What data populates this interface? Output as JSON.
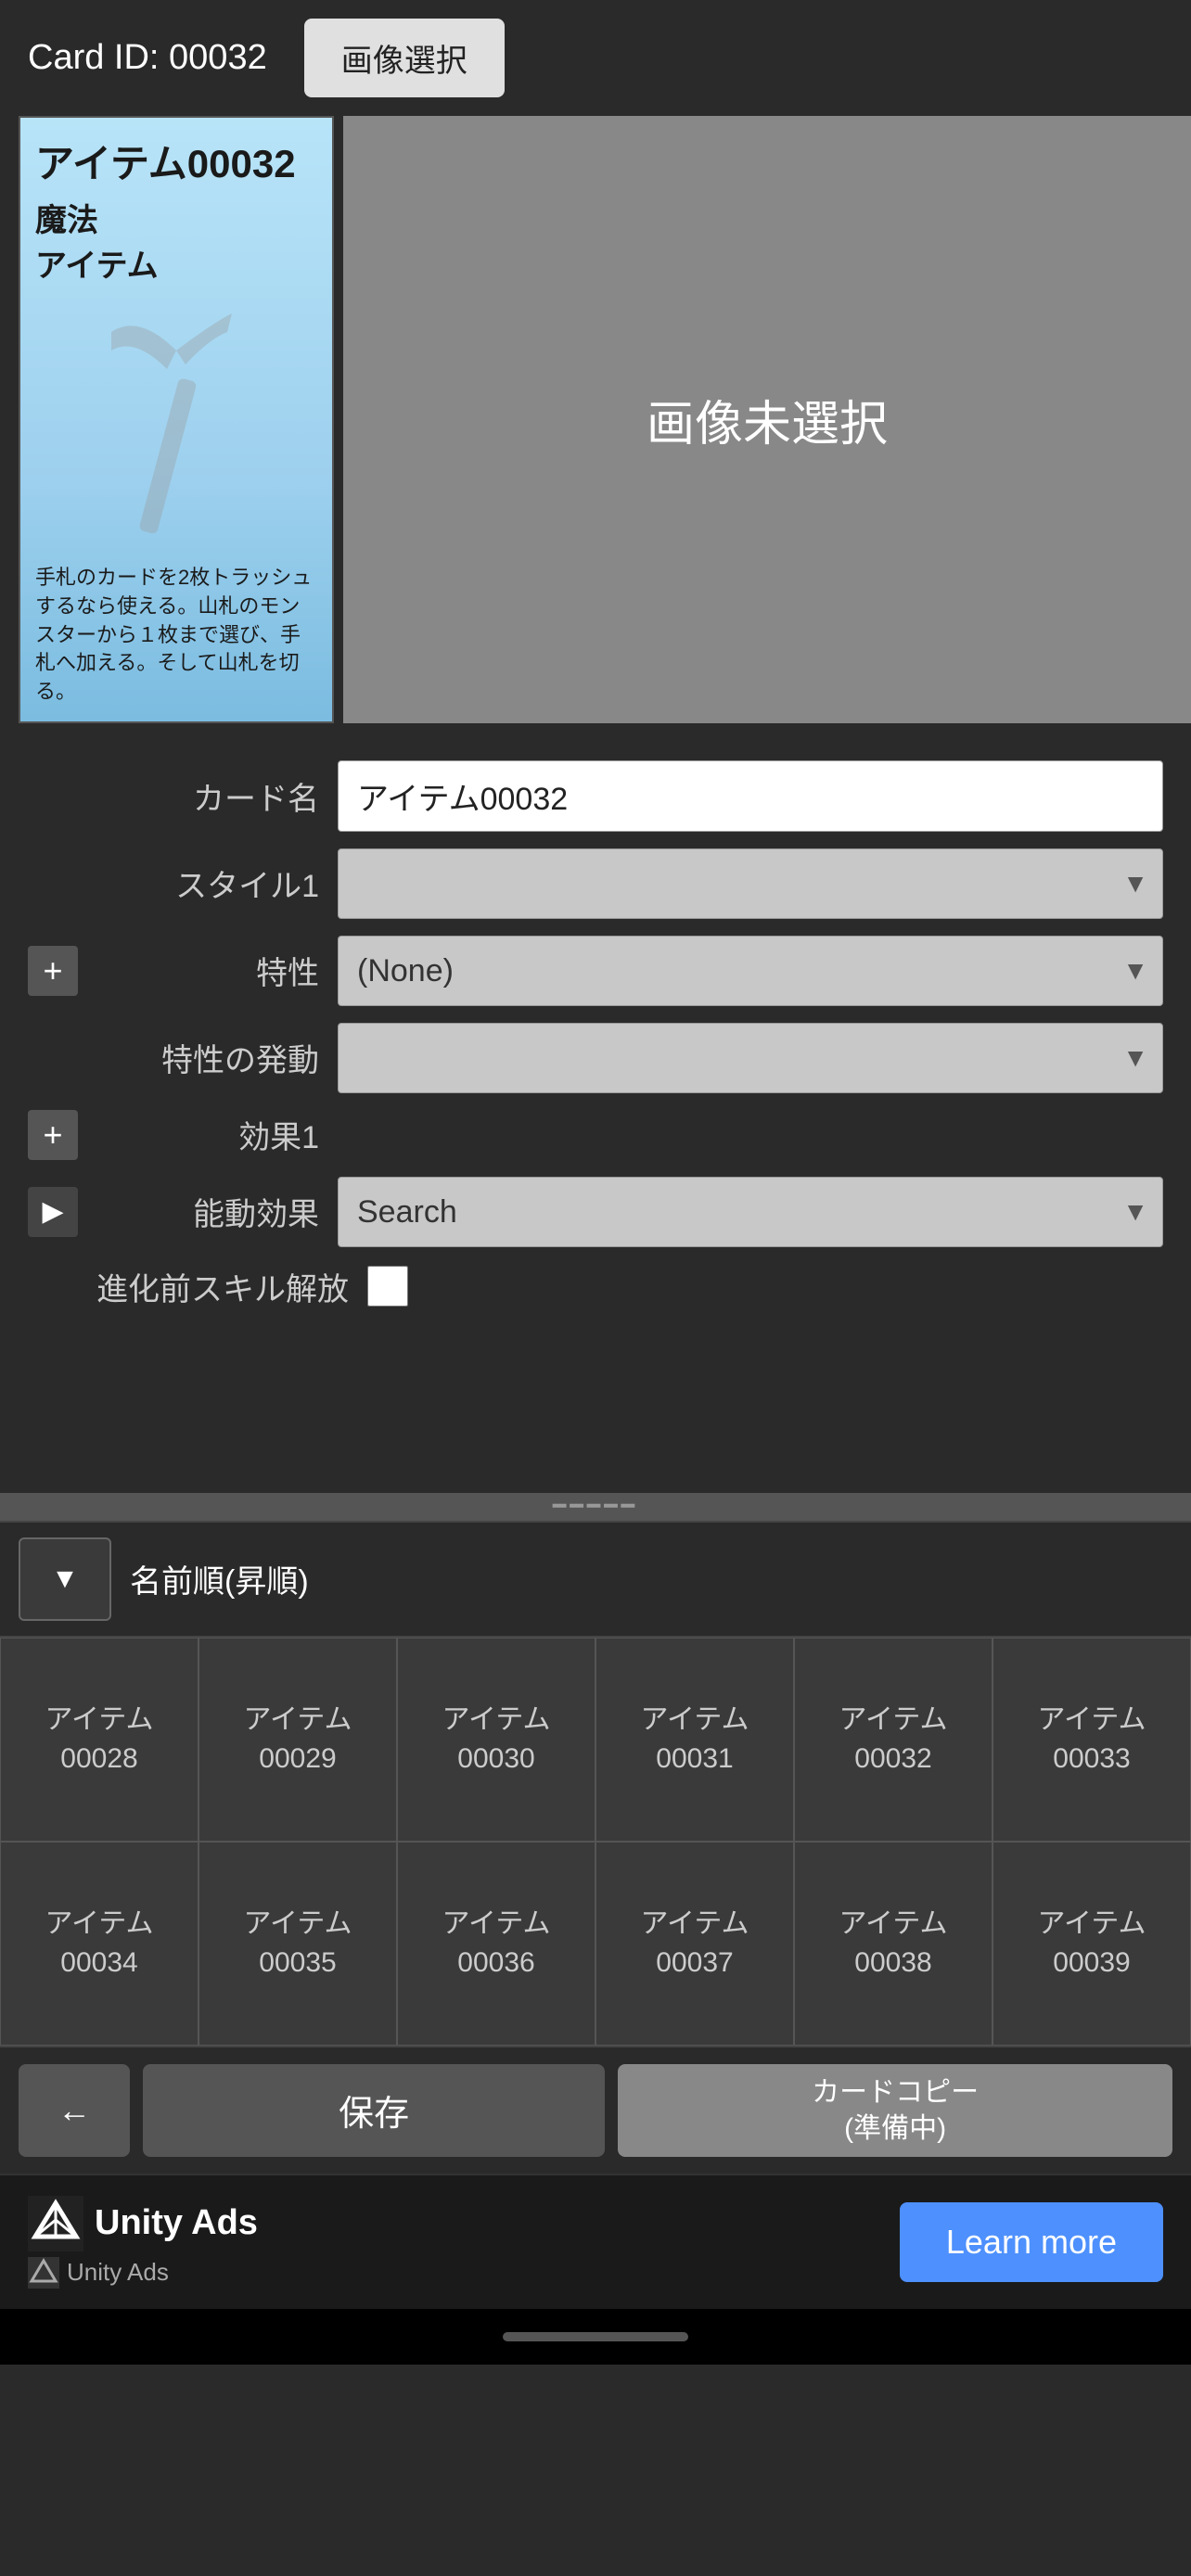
{
  "topBar": {
    "cardIdLabel": "Card ID: 00032",
    "imageSelectBtn": "画像選択"
  },
  "cardPreview": {
    "title": "アイテム00032",
    "type1": "魔法",
    "type2": "アイテム",
    "description": "手札のカードを2枚トラッシュするなら使える。山札のモンスターから１枚まで選び、手札へ加える。そして山札を切る。"
  },
  "imagePlaceholder": "画像未選択",
  "form": {
    "cardNameLabel": "カード名",
    "cardNameValue": "アイテム00032",
    "style1Label": "スタイル1",
    "style1Value": "",
    "traitLabel": "特性",
    "traitValue": "(None)",
    "traitTriggerLabel": "特性の発動",
    "traitTriggerValue": "",
    "effect1Label": "効果1",
    "passiveEffectLabel": "能動効果",
    "passiveEffectValue": "Search",
    "preEvoSkillLabel": "進化前スキル解放"
  },
  "sortBar": {
    "sortBtnArrow": "▼",
    "sortLabel": "名前順(昇順)"
  },
  "cardGrid": {
    "rows": [
      [
        {
          "label": "アイテム\n00028"
        },
        {
          "label": "アイテム\n00029"
        },
        {
          "label": "アイテム\n00030"
        },
        {
          "label": "アイテム\n00031"
        },
        {
          "label": "アイテム\n00032"
        },
        {
          "label": "アイテム\n00033"
        }
      ],
      [
        {
          "label": "アイテム\n00034"
        },
        {
          "label": "アイテム\n00035"
        },
        {
          "label": "アイテム\n00036"
        },
        {
          "label": "アイテム\n00037"
        },
        {
          "label": "アイテム\n00038"
        },
        {
          "label": "アイテム\n00039"
        }
      ]
    ]
  },
  "actionBar": {
    "backArrow": "←",
    "saveLabel": "保存",
    "copyLabel": "カードコピー\n(準備中)"
  },
  "adBar": {
    "unityAdsText": "Unity Ads",
    "unitySmallText": "Unity  Ads",
    "learnMoreLabel": "Learn more"
  },
  "homeIndicator": {}
}
